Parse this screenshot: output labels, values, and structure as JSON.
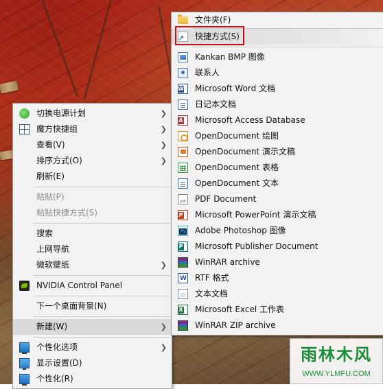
{
  "left_menu": {
    "items": [
      {
        "label": "切换电源计划",
        "icon": "power-plan-icon",
        "submenu": true
      },
      {
        "label": "魔方快捷组",
        "icon": "grid-icon",
        "submenu": true
      },
      {
        "label": "查看(V)",
        "submenu": true
      },
      {
        "label": "排序方式(O)",
        "submenu": true
      },
      {
        "label": "刷新(E)"
      },
      {
        "label": "粘贴(P)",
        "disabled": true
      },
      {
        "label": "粘贴快捷方式(S)",
        "disabled": true
      },
      {
        "label": "搜索"
      },
      {
        "label": "上网导航"
      },
      {
        "label": "微软壁纸",
        "submenu": true
      },
      {
        "label": "NVIDIA Control Panel",
        "icon": "nvidia-icon"
      },
      {
        "label": "下一个桌面背景(N)"
      },
      {
        "label": "新建(W)",
        "submenu": true,
        "highlighted": true
      },
      {
        "label": "个性化选项",
        "icon": "personalize-options-icon",
        "submenu": true
      },
      {
        "label": "显示设置(D)",
        "icon": "display-settings-icon"
      },
      {
        "label": "个性化(R)",
        "icon": "personalize-icon"
      }
    ]
  },
  "new_submenu": {
    "items": [
      {
        "label": "文件夹(F)",
        "icon": "folder-icon"
      },
      {
        "label": "快捷方式(S)",
        "icon": "shortcut-icon",
        "highlighted": true
      },
      {
        "label": "Kankan BMP 图像",
        "icon": "bmp-image-icon"
      },
      {
        "label": "联系人",
        "icon": "contact-icon"
      },
      {
        "label": "Microsoft Word 文档",
        "icon": "word-document-icon"
      },
      {
        "label": "日记本文档",
        "icon": "journal-document-icon"
      },
      {
        "label": "Microsoft Access Database",
        "icon": "access-database-icon"
      },
      {
        "label": "OpenDocument 绘图",
        "icon": "opendocument-drawing-icon"
      },
      {
        "label": "OpenDocument 演示文稿",
        "icon": "opendocument-presentation-icon"
      },
      {
        "label": "OpenDocument 表格",
        "icon": "opendocument-spreadsheet-icon"
      },
      {
        "label": "OpenDocument 文本",
        "icon": "opendocument-text-icon"
      },
      {
        "label": "PDF Document",
        "icon": "pdf-document-icon"
      },
      {
        "label": "Microsoft PowerPoint 演示文稿",
        "icon": "powerpoint-presentation-icon"
      },
      {
        "label": "Adobe Photoshop 图像",
        "icon": "photoshop-image-icon"
      },
      {
        "label": "Microsoft Publisher Document",
        "icon": "publisher-document-icon"
      },
      {
        "label": "WinRAR archive",
        "icon": "winrar-archive-icon"
      },
      {
        "label": "RTF 格式",
        "icon": "rtf-document-icon"
      },
      {
        "label": "文本文档",
        "icon": "text-document-icon"
      },
      {
        "label": "Microsoft Excel 工作表",
        "icon": "excel-worksheet-icon"
      },
      {
        "label": "WinRAR ZIP archive",
        "icon": "winrar-zip-icon"
      }
    ]
  },
  "watermark": {
    "logo_text": "雨林木风",
    "url": "WWW.YLMFU.COM"
  },
  "colors": {
    "menu_background": "#f2f2f2",
    "highlight": "#dadada",
    "annotation_box": "#c8101a",
    "watermark_green": "#1a8d3b"
  }
}
